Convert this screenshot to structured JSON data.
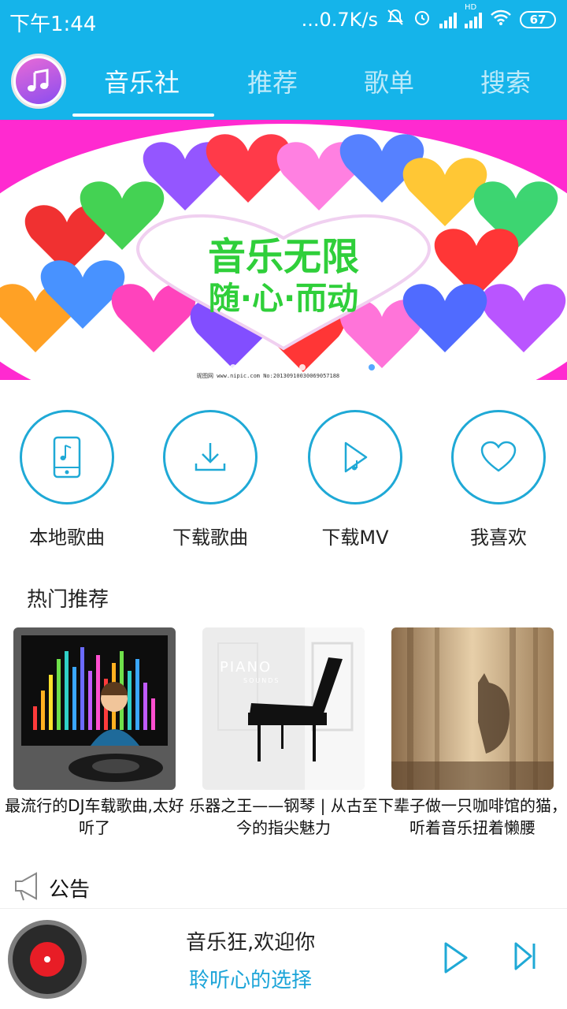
{
  "status_bar": {
    "time": "下午1:44",
    "network_speed": "...0.7K/s",
    "hd_label": "HD",
    "battery": "67",
    "icons": [
      "mute-icon",
      "alarm-icon",
      "signal-icon",
      "signal-hd-icon",
      "wifi-icon",
      "battery-icon"
    ]
  },
  "header": {
    "logo_icon": "music-note-icon",
    "tabs": [
      {
        "label": "音乐社",
        "active": true
      },
      {
        "label": "推荐",
        "active": false
      },
      {
        "label": "歌单",
        "active": false
      },
      {
        "label": "搜索",
        "active": false
      }
    ],
    "accent_color": "#15b4ea"
  },
  "banner": {
    "line1": "音乐无限",
    "line2": "随·心·而动",
    "credit": "昵图网 www.nipic.com  No:20130910030069057188",
    "dot_count": 12,
    "active_dot": 10
  },
  "quick_actions": [
    {
      "label": "本地歌曲",
      "icon": "phone-music-icon"
    },
    {
      "label": "下载歌曲",
      "icon": "download-icon"
    },
    {
      "label": "下载MV",
      "icon": "play-music-icon"
    },
    {
      "label": "我喜欢",
      "icon": "heart-icon"
    }
  ],
  "hot": {
    "title": "热门推荐",
    "cards": [
      {
        "caption": "最流行的DJ车载歌曲,太好听了"
      },
      {
        "caption": "乐器之王——钢琴 | 从古至今的指尖魅力",
        "thumb_title": "PIANO",
        "thumb_sub": "SOUNDS"
      },
      {
        "caption": "下辈子做一只咖啡馆的猫，听着音乐扭着懒腰"
      }
    ]
  },
  "notice": {
    "label": "公告",
    "icon": "megaphone-icon"
  },
  "player": {
    "song": "音乐狂,欢迎你",
    "subtitle": "聆听心的选择",
    "play_icon": "play-icon",
    "next_icon": "skip-next-icon"
  }
}
